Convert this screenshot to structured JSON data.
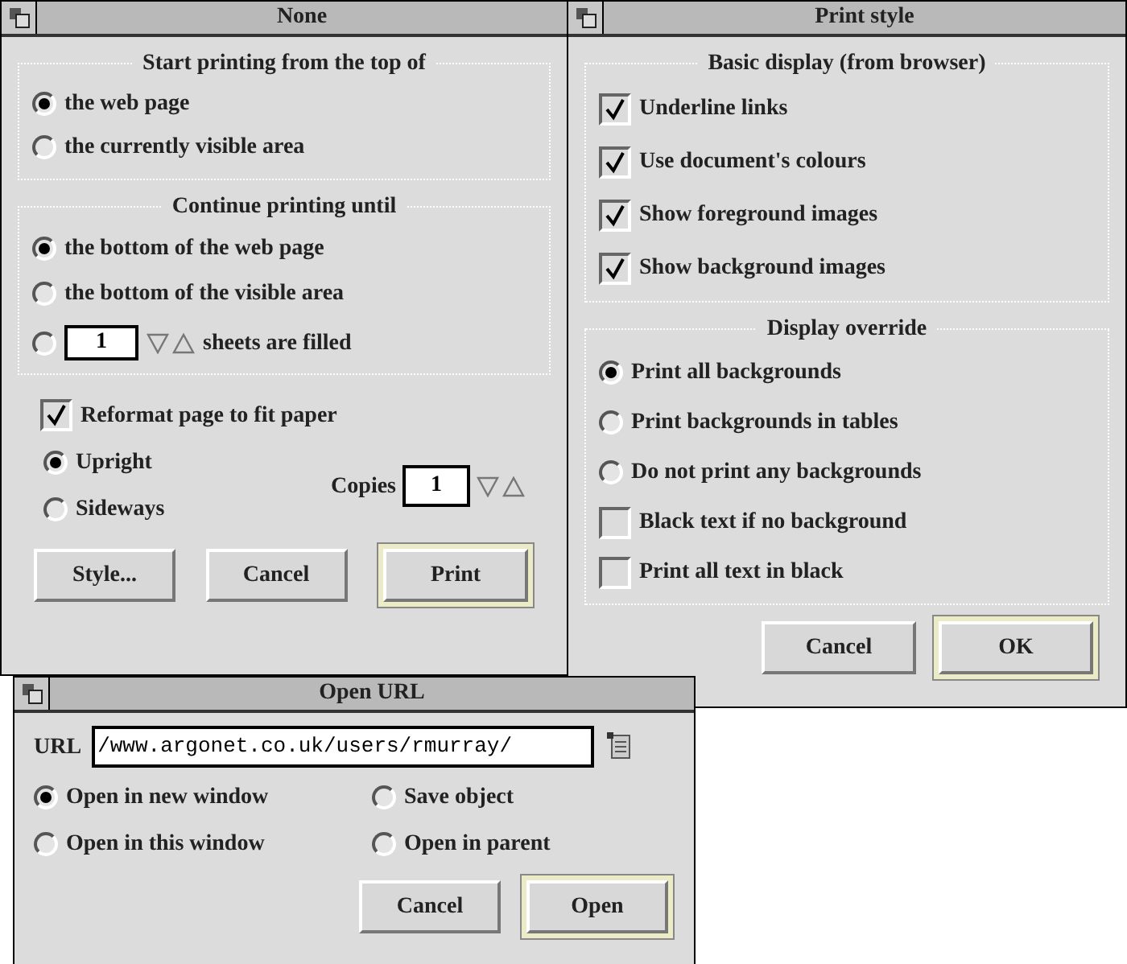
{
  "print_window": {
    "title": "None",
    "start_group": {
      "label": "Start printing from the top of",
      "options": [
        {
          "label": "the web page",
          "selected": true
        },
        {
          "label": "the currently visible area",
          "selected": false
        }
      ]
    },
    "continue_group": {
      "label": "Continue printing until",
      "options": [
        {
          "kind": "text",
          "label": "the bottom of the web page",
          "selected": true
        },
        {
          "kind": "text",
          "label": "the bottom of the visible area",
          "selected": false
        },
        {
          "kind": "sheets",
          "count": "1",
          "suffix": "sheets are filled",
          "selected": false
        }
      ]
    },
    "reformat": {
      "label": "Reformat page to fit paper",
      "checked": true
    },
    "orientation": [
      {
        "label": "Upright",
        "selected": true
      },
      {
        "label": "Sideways",
        "selected": false
      }
    ],
    "copies": {
      "label": "Copies",
      "value": "1"
    },
    "buttons": [
      {
        "label": "Style...",
        "default": false
      },
      {
        "label": "Cancel",
        "default": false
      },
      {
        "label": "Print",
        "default": true
      }
    ]
  },
  "style_window": {
    "title": "Print style",
    "basic_group": {
      "label": "Basic display (from browser)",
      "items": [
        {
          "label": "Underline links",
          "checked": true
        },
        {
          "label": "Use document's colours",
          "checked": true
        },
        {
          "label": "Show foreground images",
          "checked": true
        },
        {
          "label": "Show background images",
          "checked": true
        }
      ]
    },
    "override_group": {
      "label": "Display override",
      "items": [
        {
          "kind": "radio",
          "label": "Print all backgrounds",
          "selected": true
        },
        {
          "kind": "radio",
          "label": "Print backgrounds in tables",
          "selected": false
        },
        {
          "kind": "radio",
          "label": "Do not print any backgrounds",
          "selected": false
        },
        {
          "kind": "checkbox",
          "label": "Black text if no background",
          "checked": false
        },
        {
          "kind": "checkbox",
          "label": "Print all text in black",
          "checked": false
        }
      ]
    },
    "buttons": [
      {
        "label": "Cancel",
        "default": false
      },
      {
        "label": "OK",
        "default": true
      }
    ]
  },
  "url_window": {
    "title": "Open URL",
    "url_label": "URL",
    "url_value": "/www.argonet.co.uk/users/rmurray/",
    "options": [
      {
        "label": "Open in new window",
        "selected": true
      },
      {
        "label": "Save object",
        "selected": false
      },
      {
        "label": "Open in this window",
        "selected": false
      },
      {
        "label": "Open in parent",
        "selected": false
      }
    ],
    "buttons": [
      {
        "label": "Cancel",
        "default": false
      },
      {
        "label": "Open",
        "default": true
      }
    ]
  }
}
